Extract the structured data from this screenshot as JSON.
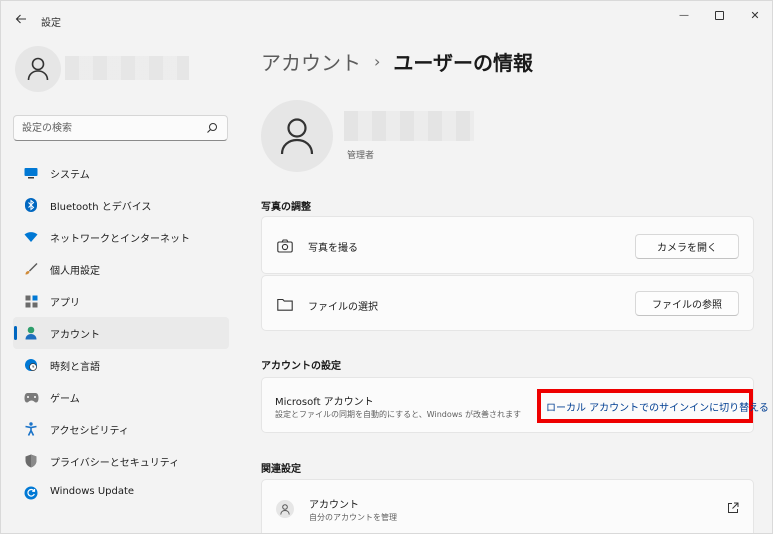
{
  "window": {
    "title": "設定",
    "back_icon": "back-arrow-icon",
    "minimize_label": "—",
    "close_label": "✕"
  },
  "sidebar": {
    "search": {
      "placeholder": "設定の検索"
    },
    "items": [
      {
        "label": "システム",
        "icon": "system-icon",
        "color": "#0078d4"
      },
      {
        "label": "Bluetooth とデバイス",
        "icon": "bluetooth-icon",
        "color": "#0067c0"
      },
      {
        "label": "ネットワークとインターネット",
        "icon": "wifi-icon",
        "color": "#0078d4"
      },
      {
        "label": "個人用設定",
        "icon": "brush-icon",
        "color": "#d08b3a"
      },
      {
        "label": "アプリ",
        "icon": "apps-icon",
        "color": "#5a5a5a"
      },
      {
        "label": "アカウント",
        "icon": "account-icon",
        "color": "#2e9e6b",
        "selected": true
      },
      {
        "label": "時刻と言語",
        "icon": "globe-clock-icon",
        "color": "#0078d4"
      },
      {
        "label": "ゲーム",
        "icon": "gamepad-icon",
        "color": "#7a7a7a"
      },
      {
        "label": "アクセシビリティ",
        "icon": "accessibility-icon",
        "color": "#1a73c8"
      },
      {
        "label": "プライバシーとセキュリティ",
        "icon": "shield-icon",
        "color": "#6b6b6b"
      },
      {
        "label": "Windows Update",
        "icon": "update-icon",
        "color": "#0078d4"
      }
    ]
  },
  "main": {
    "breadcrumb": {
      "parent": "アカウント",
      "separator": "›",
      "current": "ユーザーの情報"
    },
    "profile": {
      "role": "管理者"
    },
    "photo_section": {
      "title": "写真の調整",
      "rows": [
        {
          "label": "写真を撮る",
          "button": "カメラを開く",
          "icon": "camera-icon"
        },
        {
          "label": "ファイルの選択",
          "button": "ファイルの参照",
          "icon": "folder-icon"
        }
      ]
    },
    "account_section": {
      "title": "アカウントの設定",
      "ms_title": "Microsoft アカウント",
      "ms_desc": "設定とファイルの同期を自動的にすると、Windows が改善されます",
      "link": "ローカル アカウントでのサインインに切り替える",
      "highlight_color": "#ee0000"
    },
    "related_section": {
      "title": "関連設定",
      "item_title": "アカウント",
      "item_desc": "自分のアカウントを管理",
      "icon": "person-icon",
      "ext_icon": "external-link-icon"
    }
  }
}
